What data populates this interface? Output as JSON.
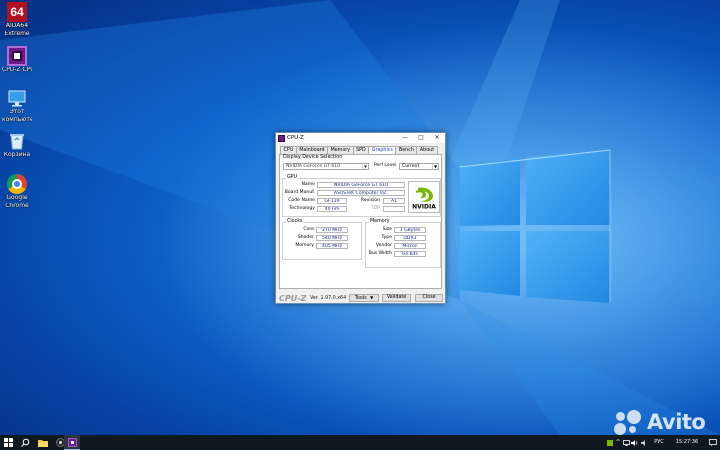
{
  "desktop": {
    "icons": [
      {
        "name": "AIDA64 Extreme",
        "badge": "64",
        "label_line1": "AIDA64",
        "label_line2": "Extreme"
      },
      {
        "name": "CPU-Z",
        "label_line1": "CPU-Z CPU-Z"
      },
      {
        "name": "Этот компьютер",
        "label_line1": "Этот",
        "label_line2": "компьютер"
      },
      {
        "name": "Корзина",
        "label_line1": "Корзина"
      },
      {
        "name": "Google Chrome",
        "label_line1": "Google",
        "label_line2": "Chrome"
      }
    ]
  },
  "cpuz": {
    "title": "CPU-Z",
    "controls": {
      "minimize": "—",
      "maximize": "□",
      "close": "✕"
    },
    "tabs": [
      "CPU",
      "Mainboard",
      "Memory",
      "SPD",
      "Graphics",
      "Bench",
      "About"
    ],
    "active_tab": "Graphics",
    "display_device_selection": {
      "label": "Display Device Selection",
      "device": "NVIDIA GeForce GT 610",
      "perf_level_label": "Perf Level",
      "perf_level_value": "Current"
    },
    "gpu": {
      "label": "GPU",
      "name_label": "Name",
      "name": "NVIDIA GeForce GT 610",
      "board_manuf_label": "Board Manuf.",
      "board_manuf": "ASUSTeK Computer Inc.",
      "code_name_label": "Code Name",
      "code_name": "GF119",
      "revision_label": "Revision",
      "revision": "A1",
      "technology_label": "Technology",
      "technology": "40 nm",
      "tdp_label": "TDP",
      "tdp": ""
    },
    "clocks": {
      "label": "Clocks",
      "core_label": "Core",
      "core": "270 MHz",
      "shader_label": "Shader",
      "shader": "540 MHz",
      "memory_label": "Memory",
      "memory": "405 MHz"
    },
    "memory": {
      "label": "Memory",
      "size_label": "Size",
      "size": "1 GBytes",
      "type_label": "Type",
      "type": "DDR3",
      "vendor_label": "Vendor",
      "vendor": "Micron",
      "bus_width_label": "Bus Width",
      "bus_width": "64 bits"
    },
    "footer": {
      "brand": "CPU-Z",
      "version": "Ver. 1.97.0.x64",
      "tools_label": "Tools",
      "validate_label": "Validate",
      "close_label": "Close"
    }
  },
  "taskbar": {
    "tray_language": "РУС",
    "time": "15:27:36"
  },
  "watermark": {
    "text": "Avito"
  },
  "colors": {
    "accent": "#1f3fb4",
    "nvidia_green": "#76b900",
    "desktop_blue": "#0a58c0"
  }
}
